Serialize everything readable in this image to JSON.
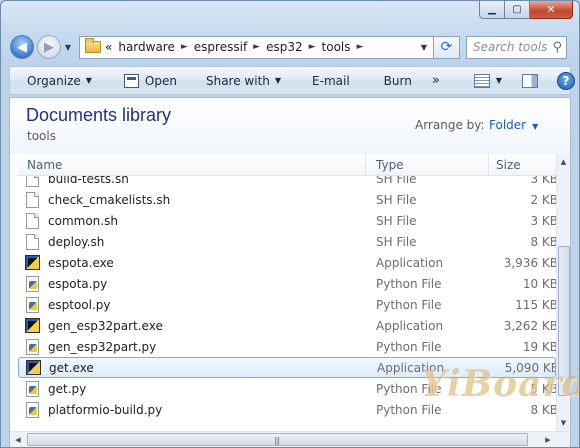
{
  "window": {
    "caption_buttons": {
      "minimize": "▁",
      "maximize": "▢",
      "close": "✕"
    }
  },
  "nav": {
    "back_icon": "back-arrow-icon",
    "forward_icon": "forward-arrow-icon"
  },
  "address": {
    "prefix_chevron": "«",
    "crumbs": [
      "hardware",
      "espressif",
      "esp32",
      "tools"
    ],
    "separator": "►"
  },
  "search": {
    "placeholder": "Search tools"
  },
  "toolbar": {
    "organize": "Organize",
    "open": "Open",
    "share_with": "Share with",
    "email": "E-mail",
    "burn": "Burn",
    "more": "»"
  },
  "library": {
    "title": "Documents library",
    "subtitle": "tools",
    "arrange_label": "Arrange by:",
    "arrange_value": "Folder"
  },
  "columns": {
    "name": "Name",
    "type": "Type",
    "size": "Size"
  },
  "files": [
    {
      "name": "build-tests.sh",
      "type": "SH File",
      "size": "3 KB",
      "icon": "document-icon"
    },
    {
      "name": "check_cmakelists.sh",
      "type": "SH File",
      "size": "2 KB",
      "icon": "document-icon"
    },
    {
      "name": "common.sh",
      "type": "SH File",
      "size": "3 KB",
      "icon": "document-icon"
    },
    {
      "name": "deploy.sh",
      "type": "SH File",
      "size": "8 KB",
      "icon": "document-icon"
    },
    {
      "name": "espota.exe",
      "type": "Application",
      "size": "3,936 KB",
      "icon": "python-exe-icon"
    },
    {
      "name": "espota.py",
      "type": "Python File",
      "size": "10 KB",
      "icon": "python-file-icon"
    },
    {
      "name": "esptool.py",
      "type": "Python File",
      "size": "115 KB",
      "icon": "python-file-icon"
    },
    {
      "name": "gen_esp32part.exe",
      "type": "Application",
      "size": "3,262 KB",
      "icon": "python-exe-icon"
    },
    {
      "name": "gen_esp32part.py",
      "type": "Python File",
      "size": "19 KB",
      "icon": "python-file-icon"
    },
    {
      "name": "get.exe",
      "type": "Application",
      "size": "5,090 KB",
      "icon": "python-exe-icon",
      "selected": true
    },
    {
      "name": "get.py",
      "type": "Python File",
      "size": "5 KB",
      "icon": "python-file-icon"
    },
    {
      "name": "platformio-build.py",
      "type": "Python File",
      "size": "8 KB",
      "icon": "python-file-icon"
    }
  ],
  "watermark": "YiBoard",
  "colors": {
    "title": "#1e3287",
    "link": "#1e5fb0",
    "selection": "#dcebfc",
    "selection_border": "#84acdd"
  }
}
